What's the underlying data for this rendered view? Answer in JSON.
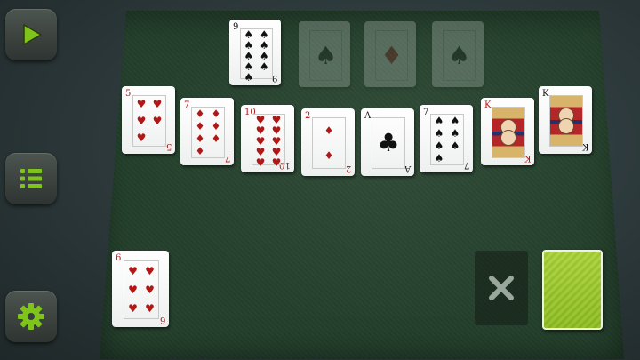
{
  "sidebar": {
    "play": {
      "icon": "play-icon",
      "color": "#7fc41a"
    },
    "menu": {
      "icon": "menu-list-icon",
      "color": "#7fc41a"
    },
    "settings": {
      "icon": "gear-icon",
      "color": "#7fc41a"
    }
  },
  "foundation": [
    {
      "rank": "9",
      "suit": "♠",
      "color": "black",
      "ghost": false
    },
    {
      "rank": "",
      "suit": "♠",
      "color": "black",
      "ghost": true
    },
    {
      "rank": "",
      "suit": "♦",
      "color": "red",
      "ghost": true
    },
    {
      "rank": "",
      "suit": "♠",
      "color": "black",
      "ghost": true
    }
  ],
  "tableau": [
    {
      "rank": "5",
      "suit": "♥",
      "color": "red"
    },
    {
      "rank": "7",
      "suit": "♦",
      "color": "red"
    },
    {
      "rank": "10",
      "suit": "♥",
      "color": "red"
    },
    {
      "rank": "2",
      "suit": "♦",
      "color": "red"
    },
    {
      "rank": "A",
      "suit": "♣",
      "color": "black"
    },
    {
      "rank": "7",
      "suit": "♠",
      "color": "black"
    },
    {
      "rank": "K",
      "suit": "♥",
      "color": "red"
    },
    {
      "rank": "K",
      "suit": "♠",
      "color": "black"
    }
  ],
  "waste": {
    "rank": "6",
    "suit": "♥",
    "color": "red"
  },
  "discard": {
    "icon": "close-x-icon"
  },
  "stock": {
    "icon": "card-back",
    "color": "#9cc92b"
  }
}
